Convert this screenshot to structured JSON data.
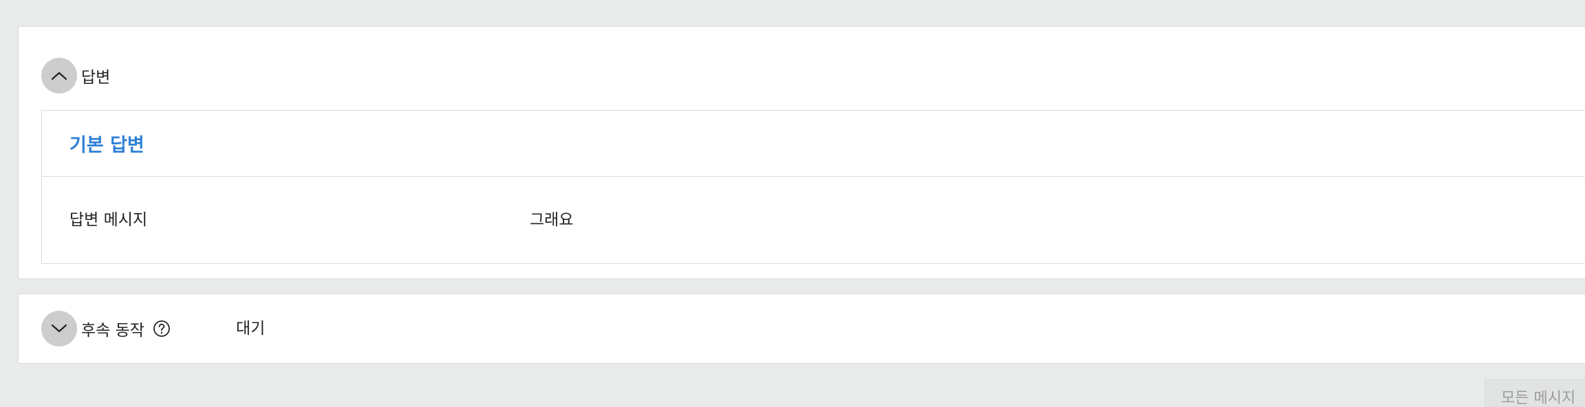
{
  "answer_section": {
    "title": "답변",
    "toggle_icon": "chevron-up-icon",
    "default_answer": {
      "title": "기본 답변",
      "message_label": "답변 메시지",
      "message_value": "그래요"
    }
  },
  "followup_section": {
    "title": "후속 동작",
    "toggle_icon": "chevron-down-icon",
    "help_icon": "question-circle-icon",
    "value": "대기"
  },
  "bottom_tab": {
    "label": "모든 메시지"
  },
  "colors": {
    "background": "#e9ebea",
    "panel": "#ffffff",
    "accent_title": "#2d7fd6",
    "toggle_button": "#cdcdcd",
    "border": "#d9dcdb"
  }
}
